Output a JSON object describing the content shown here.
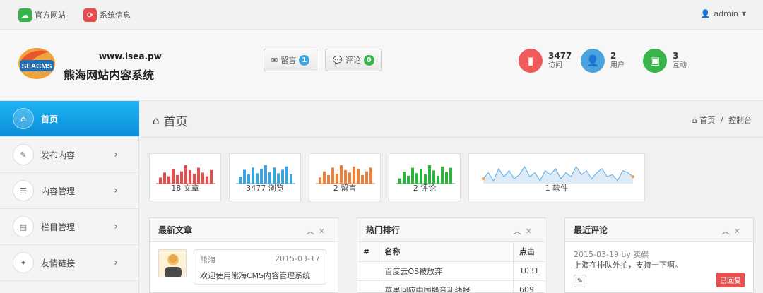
{
  "topbar": {
    "official_site": "官方网站",
    "system_info": "系统信息",
    "user": "admin"
  },
  "header": {
    "logo_text": "SEACMS",
    "site_url": "www.isea.pw",
    "site_title": "熊海网站内容系统",
    "messages_label": "留言",
    "messages_count": "1",
    "comments_label": "评论",
    "comments_count": "0",
    "stats": [
      {
        "num": "3477",
        "label": "访问",
        "color": "#ef5a5a",
        "icon": "signal-icon"
      },
      {
        "num": "2",
        "label": "用户",
        "color": "#4aa3df",
        "icon": "user-icon"
      },
      {
        "num": "3",
        "label": "互动",
        "color": "#37b44a",
        "icon": "money-icon"
      }
    ]
  },
  "sidebar": {
    "items": [
      {
        "label": "首页"
      },
      {
        "label": "发布内容"
      },
      {
        "label": "内容管理"
      },
      {
        "label": "栏目管理"
      },
      {
        "label": "友情链接"
      }
    ]
  },
  "main": {
    "title": "首页",
    "breadcrumb_home": "首页",
    "breadcrumb_sep": "/",
    "breadcrumb_current": "控制台"
  },
  "tiles": [
    {
      "label": "18 文章",
      "color": "#e84c4c",
      "values": [
        5,
        9,
        6,
        12,
        7,
        10,
        15,
        11,
        8,
        13,
        9,
        6,
        11
      ]
    },
    {
      "label": "3477 浏览",
      "color": "#3ea4e0",
      "values": [
        6,
        12,
        8,
        14,
        9,
        13,
        16,
        10,
        14,
        9,
        12,
        15,
        8
      ]
    },
    {
      "label": "2 留言",
      "color": "#f07f3a",
      "values": [
        5,
        10,
        7,
        13,
        8,
        15,
        11,
        9,
        14,
        12,
        7,
        10,
        13
      ]
    },
    {
      "label": "2 评论",
      "color": "#2bb53f",
      "values": [
        4,
        9,
        6,
        12,
        8,
        11,
        7,
        14,
        10,
        6,
        13,
        9,
        12
      ]
    }
  ],
  "sparkline": {
    "label": "1 软件",
    "color": "#6fb3e0",
    "values": [
      6,
      9,
      5,
      11,
      7,
      10,
      6,
      8,
      12,
      7,
      9,
      5,
      10,
      8,
      11,
      6,
      9,
      7,
      12,
      8,
      10,
      6,
      9,
      11,
      7,
      8,
      5,
      10,
      9,
      7
    ]
  },
  "panels": {
    "latest_title": "最新文章",
    "hot_title": "热门排行",
    "recent_title": "最近评论"
  },
  "latest_article": {
    "author": "熊海",
    "date": "2015-03-17",
    "text": "欢迎使用熊海CMS内容管理系统"
  },
  "hot_table": {
    "headers": [
      "#",
      "名称",
      "点击"
    ],
    "rows": [
      {
        "num": "",
        "name": "百度云OS被放弃",
        "clicks": "1031"
      },
      {
        "num": "",
        "name": "苹果回应中国播音乱线报",
        "clicks": "609"
      }
    ]
  },
  "recent_comment": {
    "meta": "2015-03-19 by 卖碟",
    "text": "上海在排队外拍，支持一下啊。",
    "status": "已回复"
  }
}
